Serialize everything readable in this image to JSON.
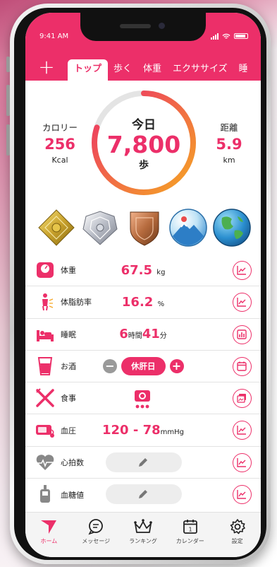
{
  "status": {
    "time": "9:41 AM"
  },
  "header": {
    "add_label": "+",
    "tabs": [
      {
        "label": "トップ",
        "active": true
      },
      {
        "label": "歩く"
      },
      {
        "label": "体重"
      },
      {
        "label": "エクササイズ"
      },
      {
        "label": "睡"
      }
    ]
  },
  "summary": {
    "calorie": {
      "label": "カロリー",
      "value": "256",
      "unit": "Kcal"
    },
    "steps": {
      "label": "今日",
      "value": "7,800",
      "unit": "歩",
      "progress": 0.8
    },
    "distance": {
      "label": "距離",
      "value": "5.9",
      "unit": "km"
    }
  },
  "badges": [
    {
      "icon": "gold-badge-icon"
    },
    {
      "icon": "silver-badge-icon"
    },
    {
      "icon": "bronze-badge-icon"
    },
    {
      "icon": "mountain-badge-icon"
    },
    {
      "icon": "globe-badge-icon"
    }
  ],
  "rows": {
    "weight": {
      "label": "体重",
      "value": "67.5",
      "unit": "kg"
    },
    "body_fat": {
      "label": "体脂肪率",
      "value": "16.2",
      "unit": "%"
    },
    "sleep": {
      "label": "睡眠",
      "hours": "6",
      "hours_unit": "時間",
      "minutes": "41",
      "minutes_unit": "分"
    },
    "alcohol": {
      "label": "お酒",
      "minus": "−",
      "button": "休肝日",
      "plus": "+"
    },
    "meal": {
      "label": "食事"
    },
    "blood_pressure": {
      "label": "血圧",
      "value": "120 - 78",
      "unit": "mmHg"
    },
    "heart_rate": {
      "label": "心拍数"
    },
    "blood_sugar": {
      "label": "血糖値"
    }
  },
  "nav": [
    {
      "label": "ホーム",
      "active": true
    },
    {
      "label": "メッセージ"
    },
    {
      "label": "ランキング"
    },
    {
      "label": "カレンダー",
      "calendar_day": "1"
    },
    {
      "label": "設定"
    }
  ],
  "colors": {
    "accent": "#ec2f69",
    "ring_gradient": [
      "#ec2f69",
      "#f5a623"
    ],
    "ring_track": "#e4e4e4"
  }
}
